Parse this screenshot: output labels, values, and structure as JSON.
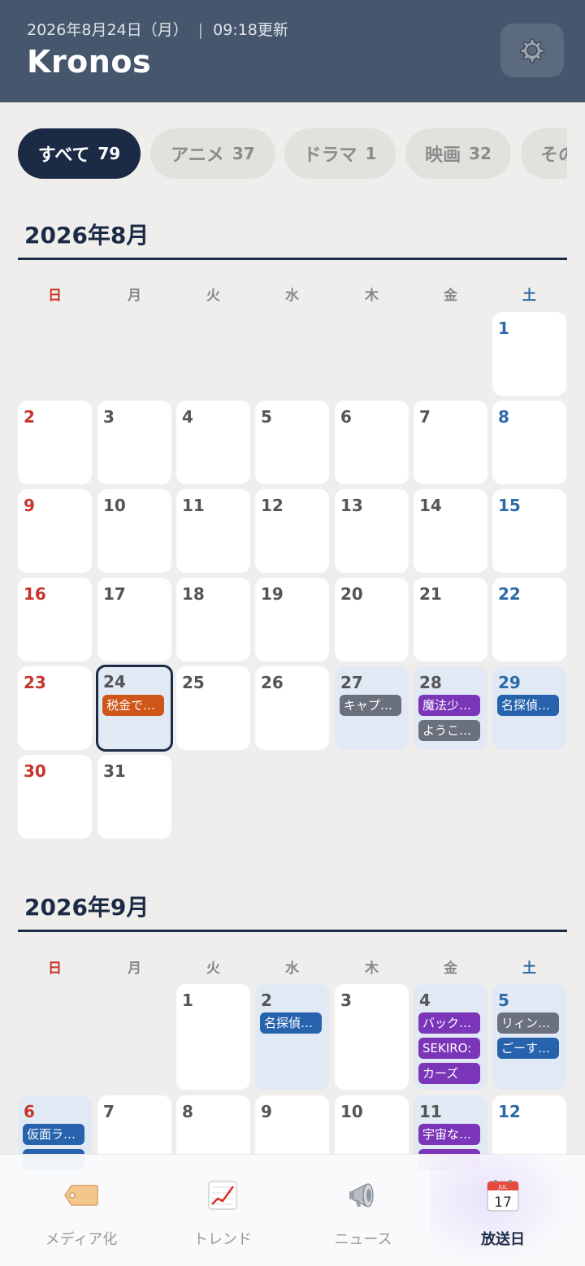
{
  "header": {
    "date": "2026年8月24日（月）",
    "separator": "|",
    "updated": "09:18更新",
    "title": "Kronos",
    "settings_icon": "gear-icon"
  },
  "filters": [
    {
      "label": "すべて",
      "count": "79",
      "active": true
    },
    {
      "label": "アニメ",
      "count": "37",
      "active": false
    },
    {
      "label": "ドラマ",
      "count": "1",
      "active": false
    },
    {
      "label": "映画",
      "count": "32",
      "active": false
    },
    {
      "label": "その",
      "count": "",
      "active": false
    }
  ],
  "weekdays": [
    "日",
    "月",
    "火",
    "水",
    "木",
    "金",
    "土"
  ],
  "months": [
    {
      "title": "2026年8月",
      "weeks": [
        [
          null,
          null,
          null,
          null,
          null,
          null,
          {
            "day": "1",
            "events": []
          }
        ],
        [
          {
            "day": "2"
          },
          {
            "day": "3"
          },
          {
            "day": "4"
          },
          {
            "day": "5"
          },
          {
            "day": "6"
          },
          {
            "day": "7"
          },
          {
            "day": "8"
          }
        ],
        [
          {
            "day": "9"
          },
          {
            "day": "10"
          },
          {
            "day": "11"
          },
          {
            "day": "12"
          },
          {
            "day": "13"
          },
          {
            "day": "14"
          },
          {
            "day": "15"
          }
        ],
        [
          {
            "day": "16"
          },
          {
            "day": "17"
          },
          {
            "day": "18"
          },
          {
            "day": "19"
          },
          {
            "day": "20"
          },
          {
            "day": "21"
          },
          {
            "day": "22"
          }
        ],
        [
          {
            "day": "23"
          },
          {
            "day": "24",
            "today": true,
            "events": [
              {
                "title": "税金で…",
                "color": "orange"
              }
            ]
          },
          {
            "day": "25"
          },
          {
            "day": "26"
          },
          {
            "day": "27",
            "events": [
              {
                "title": "キャプ…",
                "color": "gray"
              }
            ]
          },
          {
            "day": "28",
            "events": [
              {
                "title": "魔法少…",
                "color": "purple"
              },
              {
                "title": "ようこ…",
                "color": "gray"
              }
            ]
          },
          {
            "day": "29",
            "events": [
              {
                "title": "名探偵…",
                "color": "blue"
              }
            ]
          }
        ],
        [
          {
            "day": "30"
          },
          {
            "day": "31"
          },
          null,
          null,
          null,
          null,
          null
        ]
      ]
    },
    {
      "title": "2026年9月",
      "weeks": [
        [
          null,
          null,
          {
            "day": "1"
          },
          {
            "day": "2",
            "events": [
              {
                "title": "名探偵…",
                "color": "blue"
              }
            ]
          },
          {
            "day": "3"
          },
          {
            "day": "4",
            "events": [
              {
                "title": "バック…",
                "color": "purple"
              },
              {
                "title": "SEKIRO:",
                "color": "purple"
              },
              {
                "title": "カーズ",
                "color": "purple"
              }
            ]
          },
          {
            "day": "5",
            "events": [
              {
                "title": "リィン…",
                "color": "gray"
              },
              {
                "title": "ごーす…",
                "color": "blue"
              }
            ]
          }
        ],
        [
          {
            "day": "6",
            "events": [
              {
                "title": "仮面ラ…",
                "color": "blue"
              },
              {
                "title": "",
                "color": "blue"
              }
            ]
          },
          {
            "day": "7"
          },
          {
            "day": "8"
          },
          {
            "day": "9"
          },
          {
            "day": "10"
          },
          {
            "day": "11",
            "events": [
              {
                "title": "宇宙な…",
                "color": "purple"
              },
              {
                "title": "",
                "color": "purple"
              }
            ]
          },
          {
            "day": "12"
          }
        ]
      ]
    }
  ],
  "bottom_nav": [
    {
      "label": "メディア化",
      "icon": "tag-icon",
      "active": false
    },
    {
      "label": "トレンド",
      "icon": "chart-increasing-icon",
      "active": false
    },
    {
      "label": "ニュース",
      "icon": "megaphone-icon",
      "active": false
    },
    {
      "label": "放送日",
      "icon": "calendar-icon",
      "active": true,
      "icon_month": "JUL",
      "icon_day": "17"
    }
  ],
  "colors": {
    "header_bg": "#46566c",
    "accent_navy": "#1c2b45",
    "sunday": "#c8352a",
    "saturday": "#2c6aa8",
    "event_orange": "#cf5518",
    "event_gray": "#6b717c",
    "event_purple": "#7a35b8",
    "event_blue": "#2763ad"
  }
}
